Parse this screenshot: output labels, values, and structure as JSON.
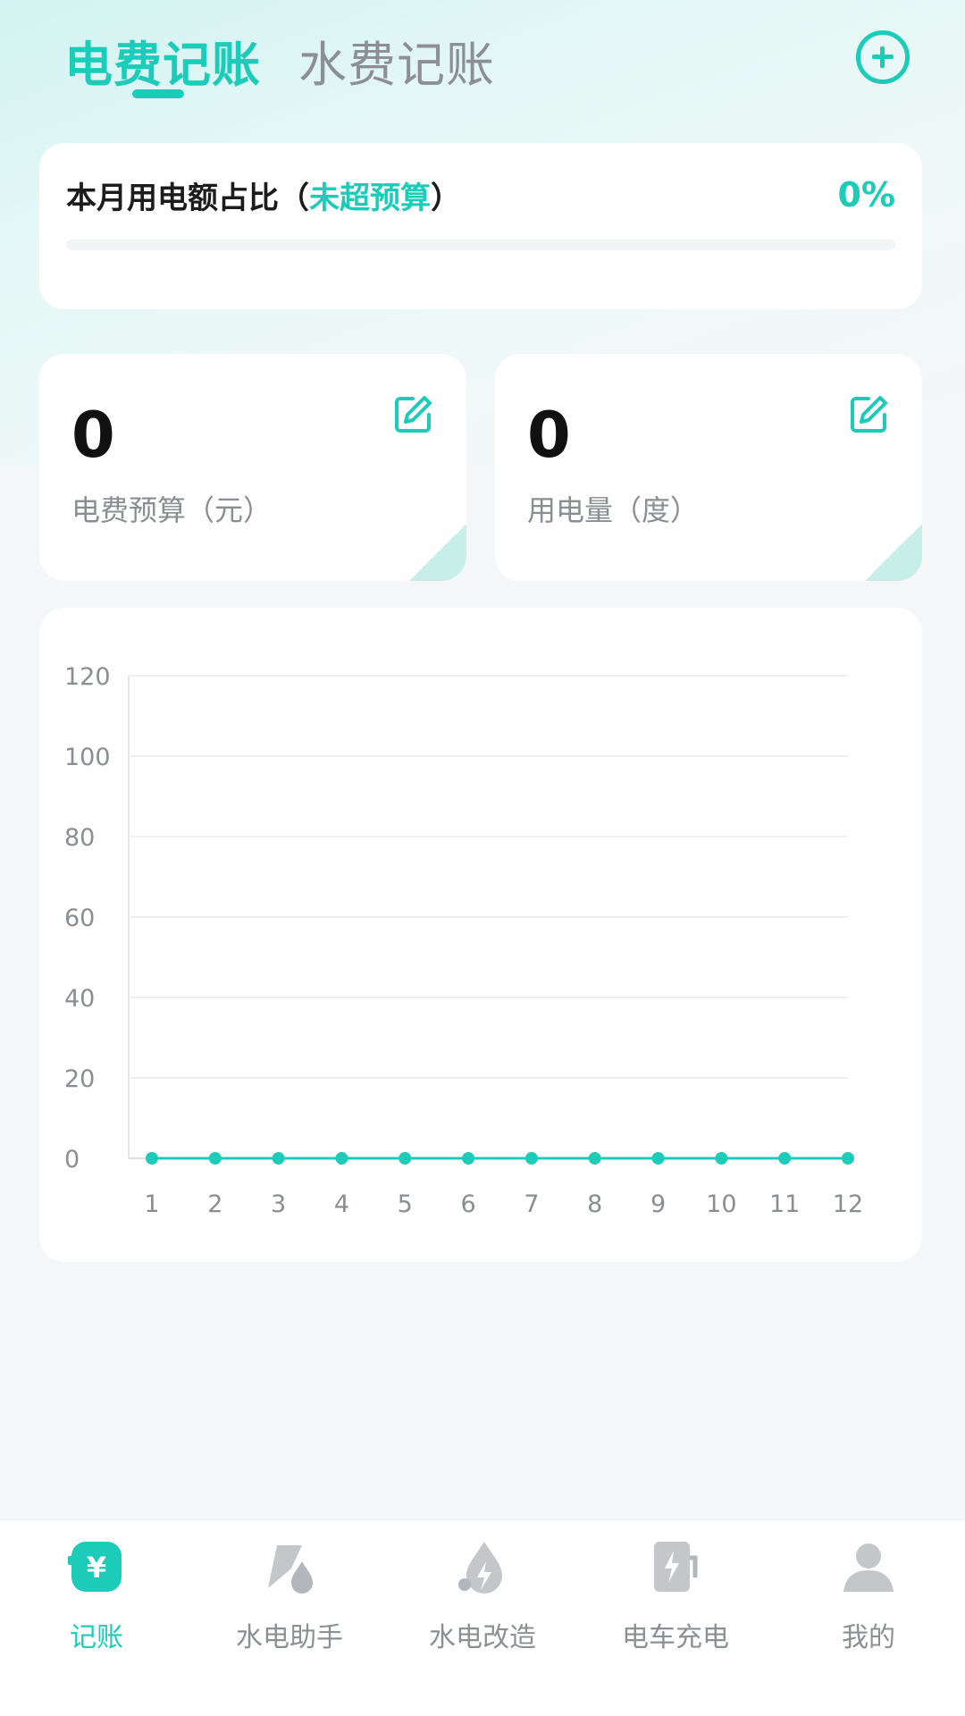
{
  "colors": {
    "accent": "#1dcbb9",
    "inactive_text": "#8c8f93",
    "icon_gray": "#c4c6c9",
    "card_bg": "#ffffff",
    "page_bg": "#f5f6f7"
  },
  "header": {
    "tabs": [
      {
        "label": "电费记账",
        "active": true
      },
      {
        "label": "水费记账",
        "active": false
      }
    ],
    "add_icon": "plus-circle-icon"
  },
  "budget_card": {
    "title_prefix": "本月用电额占比（",
    "status": "未超预算",
    "title_suffix": "）",
    "percent_label": "0%",
    "progress": 0
  },
  "stats": [
    {
      "value": "0",
      "label": "电费预算（元）",
      "icon": "edit-icon"
    },
    {
      "value": "0",
      "label": "用电量（度）",
      "icon": "edit-icon"
    }
  ],
  "chart_data": {
    "type": "line",
    "x": [
      1,
      2,
      3,
      4,
      5,
      6,
      7,
      8,
      9,
      10,
      11,
      12
    ],
    "series": [
      {
        "values": [
          0,
          0,
          0,
          0,
          0,
          0,
          0,
          0,
          0,
          0,
          0,
          0
        ],
        "color": "#1dcbb9"
      }
    ],
    "ylim": [
      0,
      120
    ],
    "yticks": [
      0,
      20,
      40,
      60,
      80,
      100,
      120
    ],
    "grid": true,
    "title": "",
    "xlabel": "",
    "ylabel": ""
  },
  "bottom_nav": [
    {
      "label": "记账",
      "icon": "yen-wallet-icon",
      "active": true
    },
    {
      "label": "水电助手",
      "icon": "water-electric-assistant-icon",
      "active": false
    },
    {
      "label": "水电改造",
      "icon": "water-drop-bolt-icon",
      "active": false
    },
    {
      "label": "电车充电",
      "icon": "ev-charging-icon",
      "active": false
    },
    {
      "label": "我的",
      "icon": "user-icon",
      "active": false
    }
  ]
}
